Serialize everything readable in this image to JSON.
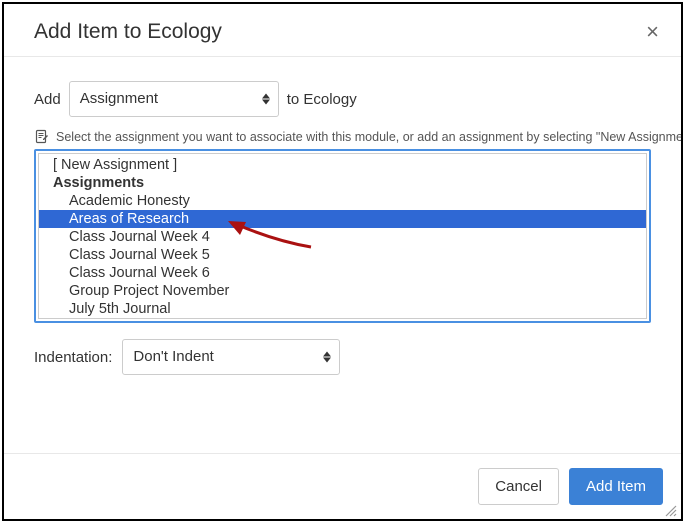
{
  "header": {
    "title": "Add Item to Ecology",
    "close_label": "×"
  },
  "add_line": {
    "prefix": "Add",
    "type_selected": "Assignment",
    "suffix": "to Ecology"
  },
  "hint": "Select the assignment you want to associate with this module, or add an assignment by selecting \"New Assignment\".",
  "listbox": {
    "items": [
      {
        "label": "[ New Assignment ]",
        "kind": "new",
        "selected": false
      },
      {
        "label": "Assignments",
        "kind": "group",
        "selected": false
      },
      {
        "label": "Academic Honesty",
        "kind": "child",
        "selected": false
      },
      {
        "label": "Areas of Research",
        "kind": "child",
        "selected": true
      },
      {
        "label": "Class Journal Week 4",
        "kind": "child",
        "selected": false
      },
      {
        "label": "Class Journal Week 5",
        "kind": "child",
        "selected": false
      },
      {
        "label": "Class Journal Week 6",
        "kind": "child",
        "selected": false
      },
      {
        "label": "Group Project November",
        "kind": "child",
        "selected": false
      },
      {
        "label": "July 5th Journal",
        "kind": "child",
        "selected": false
      }
    ]
  },
  "indentation": {
    "label": "Indentation:",
    "selected": "Don't Indent"
  },
  "footer": {
    "cancel": "Cancel",
    "add": "Add Item"
  }
}
